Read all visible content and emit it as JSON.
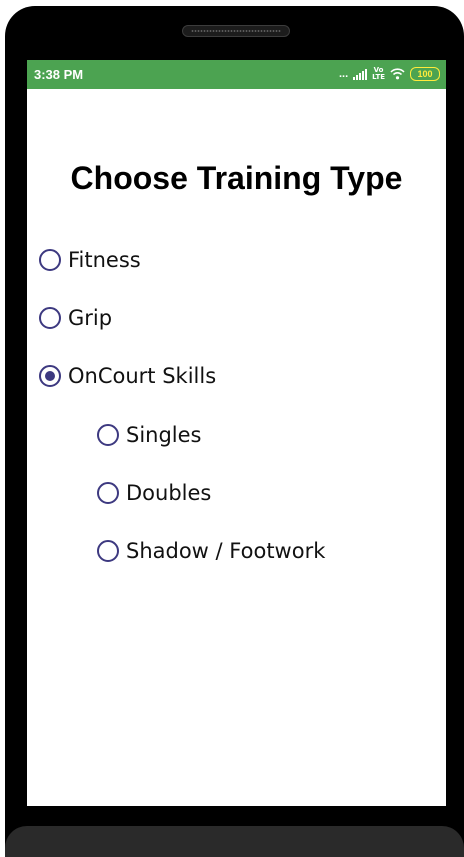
{
  "status_bar": {
    "time": "3:38 PM",
    "dots": "...",
    "network_label": "Vo\nLTE",
    "battery": "100",
    "icons": [
      "signal-icon",
      "volte-icon",
      "wifi-icon",
      "battery-icon"
    ],
    "background_color": "#4ca351",
    "battery_color": "#ffeb3b"
  },
  "page": {
    "title": "Choose Training Type"
  },
  "options": [
    {
      "label": "Fitness",
      "checked": false
    },
    {
      "label": "Grip",
      "checked": false
    },
    {
      "label": "OnCourt Skills",
      "checked": true
    }
  ],
  "sub_options": [
    {
      "label": "Singles",
      "checked": false
    },
    {
      "label": "Doubles",
      "checked": false
    },
    {
      "label": "Shadow / Footwork",
      "checked": false
    }
  ],
  "accent_color": "#3d3980"
}
